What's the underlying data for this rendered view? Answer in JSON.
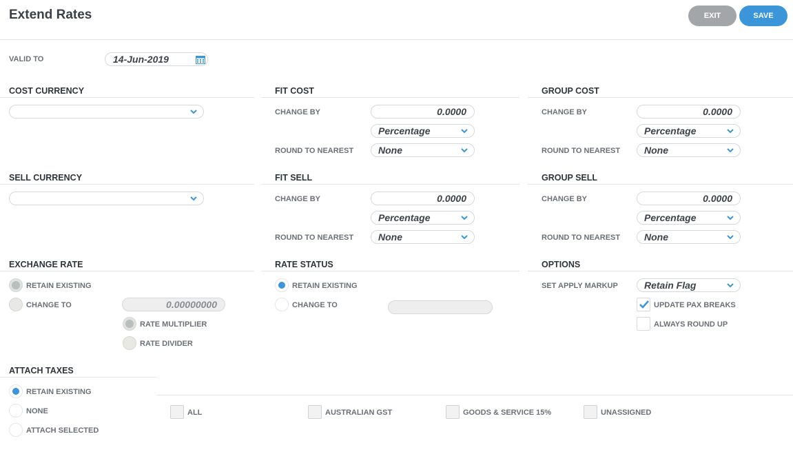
{
  "header": {
    "title": "Extend Rates",
    "exit_label": "EXIT",
    "save_label": "SAVE"
  },
  "valid_to": {
    "label": "VALID TO",
    "value": "14-Jun-2019"
  },
  "cost_currency": {
    "title": "COST CURRENCY",
    "value": ""
  },
  "sell_currency": {
    "title": "SELL CURRENCY",
    "value": ""
  },
  "fit_cost": {
    "title": "FIT COST",
    "change_by_label": "CHANGE BY",
    "change_by": "0.0000",
    "mode": "Percentage",
    "round_label": "ROUND TO NEAREST",
    "round": "None"
  },
  "group_cost": {
    "title": "GROUP COST",
    "change_by_label": "CHANGE BY",
    "change_by": "0.0000",
    "mode": "Percentage",
    "round_label": "ROUND TO NEAREST",
    "round": "None"
  },
  "fit_sell": {
    "title": "FIT SELL",
    "change_by_label": "CHANGE BY",
    "change_by": "0.0000",
    "mode": "Percentage",
    "round_label": "ROUND TO NEAREST",
    "round": "None"
  },
  "group_sell": {
    "title": "GROUP SELL",
    "change_by_label": "CHANGE BY",
    "change_by": "0.0000",
    "mode": "Percentage",
    "round_label": "ROUND TO NEAREST",
    "round": "None"
  },
  "exchange_rate": {
    "title": "EXCHANGE RATE",
    "retain_label": "RETAIN EXISTING",
    "change_label": "CHANGE TO",
    "change_value": "0.00000000",
    "multiplier_label": "RATE MULTIPLIER",
    "divider_label": "RATE DIVIDER"
  },
  "rate_status": {
    "title": "RATE STATUS",
    "retain_label": "RETAIN EXISTING",
    "change_label": "CHANGE TO",
    "change_value": ""
  },
  "options": {
    "title": "OPTIONS",
    "markup_label": "SET APPLY MARKUP",
    "markup_value": "Retain Flag",
    "update_pax_label": "UPDATE PAX BREAKS",
    "round_up_label": "ALWAYS ROUND UP"
  },
  "attach_taxes": {
    "title": "ATTACH TAXES",
    "retain_label": "RETAIN EXISTING",
    "none_label": "NONE",
    "selected_label": "ATTACH SELECTED",
    "taxes": [
      "ALL",
      "AUSTRALIAN GST",
      "GOODS & SERVICE 15%",
      "UNASSIGNED"
    ]
  },
  "colors": {
    "accent": "#3a95d9",
    "exit": "#a3a6a9"
  },
  "icons": {
    "calendar": "calendar-icon",
    "dropdown": "chevron-down-icon",
    "check": "checkmark-icon"
  }
}
